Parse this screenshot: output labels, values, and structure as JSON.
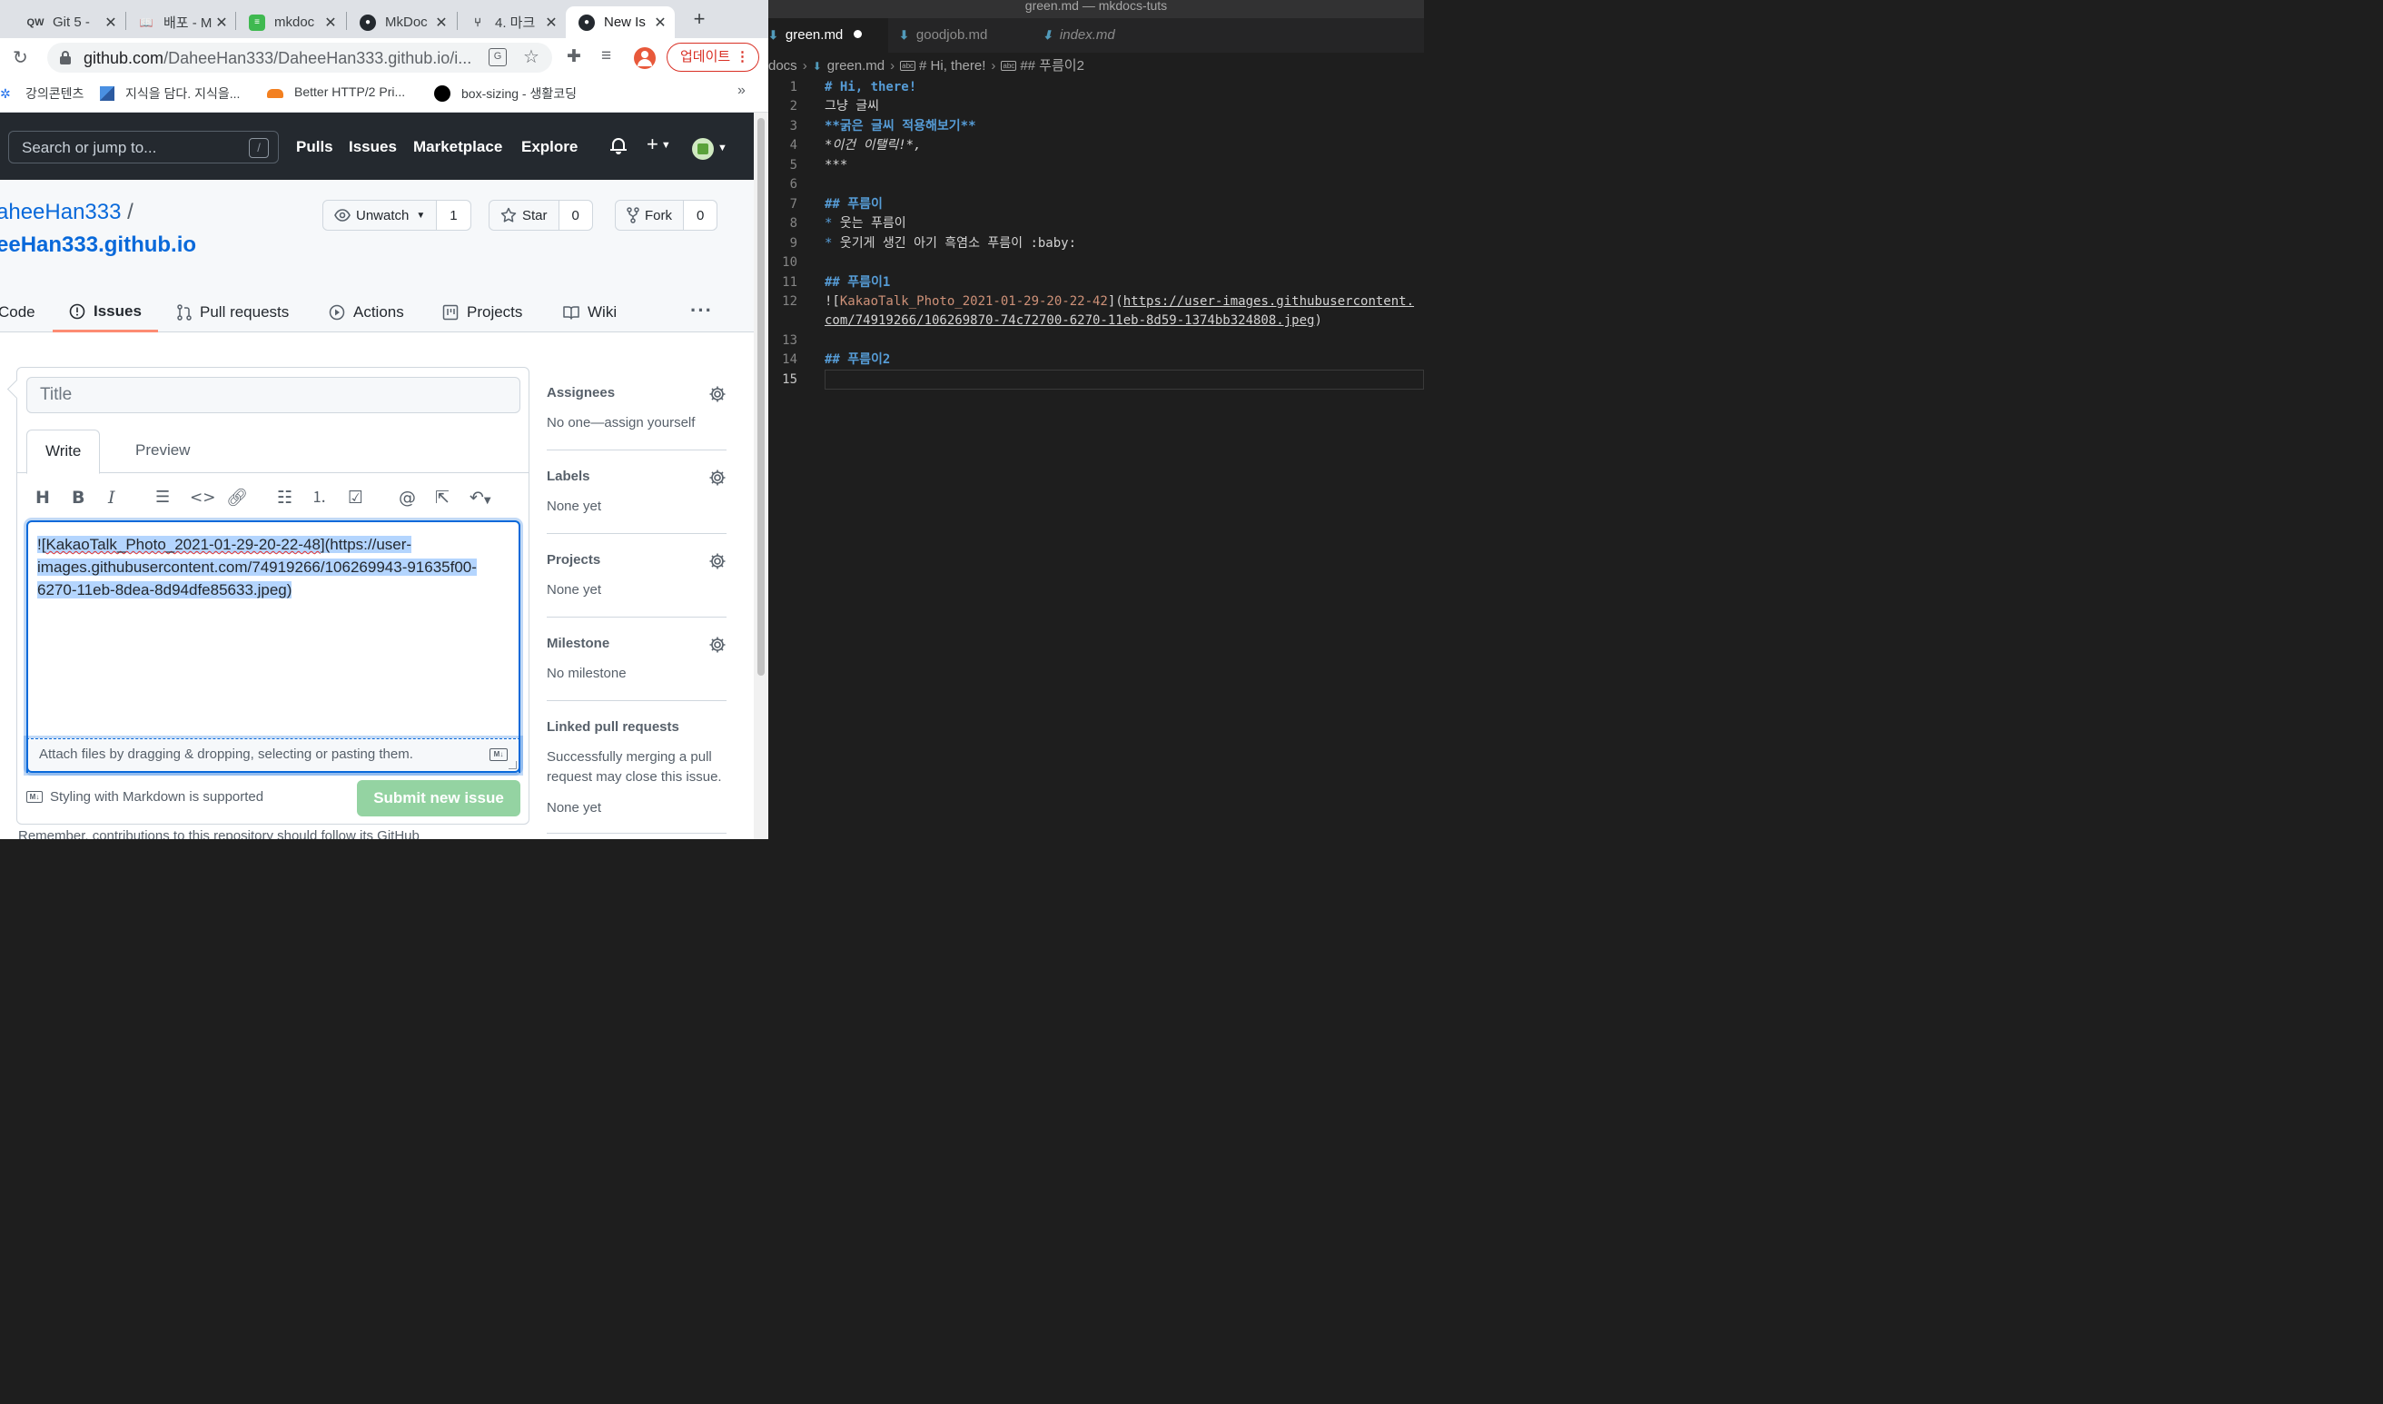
{
  "browser": {
    "tabs": [
      {
        "title": "Git 5 - "
      },
      {
        "title": "배포 - M"
      },
      {
        "title": "mkdoc"
      },
      {
        "title": "MkDoc"
      },
      {
        "title": "4. 마크"
      },
      {
        "title": "New Is"
      }
    ],
    "new_tab": "+",
    "url_domain": "github.com",
    "url_rest": "/DaheeHan333/DaheeHan333.github.io/i...",
    "update_label": "업데이트",
    "bookmarks": [
      {
        "label": "강의콘텐츠"
      },
      {
        "label": "지식을 담다. 지식을..."
      },
      {
        "label": "Better HTTP/2 Pri..."
      },
      {
        "label": "box-sizing - 생활코딩"
      }
    ],
    "bookmarks_more": "»"
  },
  "github": {
    "search_placeholder": "Search or jump to...",
    "search_key": "/",
    "nav": [
      "Pulls",
      "Issues",
      "Marketplace",
      "Explore"
    ],
    "owner": "aheeHan333",
    "owner_sep": "/",
    "repo": "eeHan333.github.io",
    "watch": {
      "label": "Unwatch",
      "count": "1"
    },
    "star": {
      "label": "Star",
      "count": "0"
    },
    "fork": {
      "label": "Fork",
      "count": "0"
    },
    "repo_tabs": [
      "Code",
      "Issues",
      "Pull requests",
      "Actions",
      "Projects",
      "Wiki"
    ],
    "more": "···",
    "form": {
      "title_placeholder": "Title",
      "tab_write": "Write",
      "tab_preview": "Preview",
      "body_link_text": "KakaoTalk_Photo_2021-01-29-20-22-48",
      "body_line1_rest": "(https://user-",
      "body_line2": "images.githubusercontent.com/74919266/106269943-91635f00-",
      "body_line3": "6270-11eb-8dea-8d94dfe85633.jpeg)",
      "attach_text": "Attach files by dragging & dropping, selecting or pasting them.",
      "markdown_note": "Styling with Markdown is supported",
      "submit_label": "Submit new issue",
      "below_text": "Remember, contributions to this repository should follow its GitHub"
    },
    "sidebar": [
      {
        "heading": "Assignees",
        "value": "No one—assign yourself"
      },
      {
        "heading": "Labels",
        "value": "None yet"
      },
      {
        "heading": "Projects",
        "value": "None yet"
      },
      {
        "heading": "Milestone",
        "value": "No milestone"
      },
      {
        "heading": "Linked pull requests",
        "value": "Successfully merging a pull request may close this issue.",
        "value2": "None yet"
      }
    ]
  },
  "vscode": {
    "window_title": "green.md — mkdocs-tuts",
    "tabs": [
      {
        "label": "green.md",
        "modified": true
      },
      {
        "label": "goodjob.md"
      },
      {
        "label": "index.md"
      }
    ],
    "breadcrumb": {
      "folder": "docs",
      "file": "green.md",
      "h1": "# Hi, there!",
      "h2": "## 푸름이2"
    },
    "line_numbers": [
      "1",
      "2",
      "3",
      "4",
      "5",
      "6",
      "7",
      "8",
      "9",
      "10",
      "11",
      "12",
      "13",
      "14",
      "15"
    ],
    "lines": {
      "l1": "# Hi, there!",
      "l2": "그냥 글씨",
      "l3": "**굵은 글씨 적용해보기**",
      "l4": "*이건 이탤릭!*,",
      "l5": "***",
      "l7": "## 푸름이",
      "l8_bullet": "* ",
      "l8": "웃는 푸름이",
      "l9_bullet": "* ",
      "l9": "웃기게 생긴 아기 흑염소 푸름이 :baby:",
      "l11": "## 푸름이1",
      "l12_pre": "![",
      "l12_alt": "KakaoTalk_Photo_2021-01-29-20-22-42",
      "l12_mid": "](",
      "l12_url": "https://user-images.githubusercontent.",
      "l12b_url": "com/74919266/106269870-74c72700-6270-11eb-8d59-1374bb324808.jpeg",
      "l12b_end": ")",
      "l14": "## 푸름이2"
    }
  }
}
